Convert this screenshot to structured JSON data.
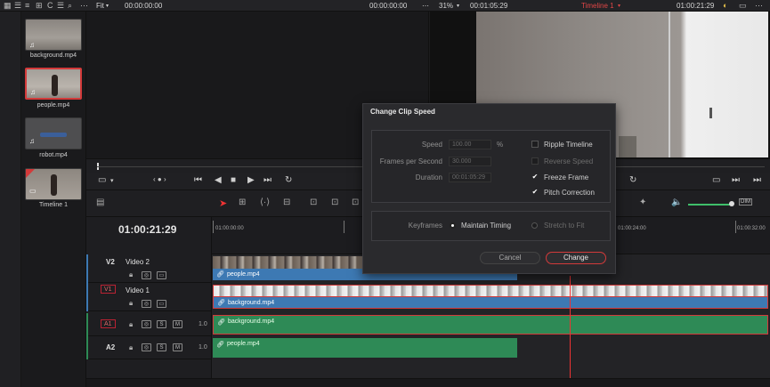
{
  "topbar": {
    "fit_label": "Fit",
    "source_tc": "00:00:00:00",
    "source_tc2": "00:00:00:00",
    "zoom": "31%",
    "dur_tc": "00:01:05:29",
    "timeline_name": "Timeline 1",
    "program_tc": "01:00:21:29"
  },
  "media_pool": {
    "clips": [
      {
        "label": "background.mp4"
      },
      {
        "label": "people.mp4"
      },
      {
        "label": "robot.mp4"
      },
      {
        "label": "Timeline 1"
      }
    ]
  },
  "timeline": {
    "timecode": "01:00:21:29",
    "ruler_marks": [
      "01:00:00:00",
      "01:00:24:00",
      "01:00:32:00"
    ],
    "tracks": {
      "v2": {
        "id": "V2",
        "name": "Video 2"
      },
      "v1": {
        "id": "V1",
        "name": "Video 1"
      },
      "a1": {
        "id": "A1",
        "level": "1.0"
      },
      "a2": {
        "id": "A2",
        "level": "1.0"
      }
    },
    "clips": {
      "v2_people": "people.mp4",
      "v1_background": "background.mp4",
      "a1_background": "background.mp4",
      "a2_people": "people.mp4"
    }
  },
  "dialog": {
    "title": "Change Clip Speed",
    "speed_label": "Speed",
    "speed_value": "100.00",
    "speed_unit": "%",
    "fps_label": "Frames per Second",
    "fps_value": "30.000",
    "duration_label": "Duration",
    "duration_value": "00:01:05:29",
    "ripple_label": "Ripple Timeline",
    "reverse_label": "Reverse Speed",
    "freeze_label": "Freeze Frame",
    "pitch_label": "Pitch Correction",
    "keyframes_label": "Keyframes",
    "maintain_label": "Maintain Timing",
    "stretch_label": "Stretch to Fit",
    "cancel_label": "Cancel",
    "change_label": "Change"
  },
  "colors": {
    "accent_red": "#d33a3a",
    "video_clip": "#3d79b3",
    "audio_clip": "#2e8a56",
    "playhead": "#e33333"
  }
}
